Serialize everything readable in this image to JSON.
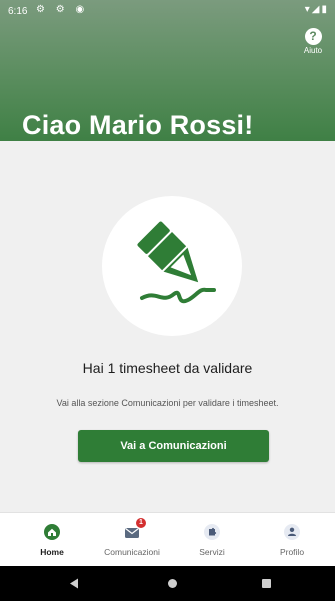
{
  "status": {
    "time": "6:16",
    "left_icons": "⚙ ⚙ ◉",
    "right_icons": "▾◢▮"
  },
  "header": {
    "help_label": "Aiuto",
    "help_symbol": "?",
    "greeting": "Ciao Mario Rossi!"
  },
  "main": {
    "title": "Hai 1 timesheet da validare",
    "subtitle": "Vai alla sezione Comunicazioni per validare i timesheet.",
    "cta_label": "Vai a Comunicazioni",
    "illustration_icon": "pen-signature-icon"
  },
  "tabs": [
    {
      "label": "Home",
      "icon": "home-icon",
      "active": true
    },
    {
      "label": "Comunicazioni",
      "icon": "mail-icon",
      "badge": "1"
    },
    {
      "label": "Servizi",
      "icon": "puzzle-icon"
    },
    {
      "label": "Profilo",
      "icon": "person-icon"
    }
  ],
  "colors": {
    "brand": "#2f7d36",
    "header_top": "#7b9b7e",
    "header_bottom": "#3f8045",
    "badge": "#d32f2f"
  }
}
